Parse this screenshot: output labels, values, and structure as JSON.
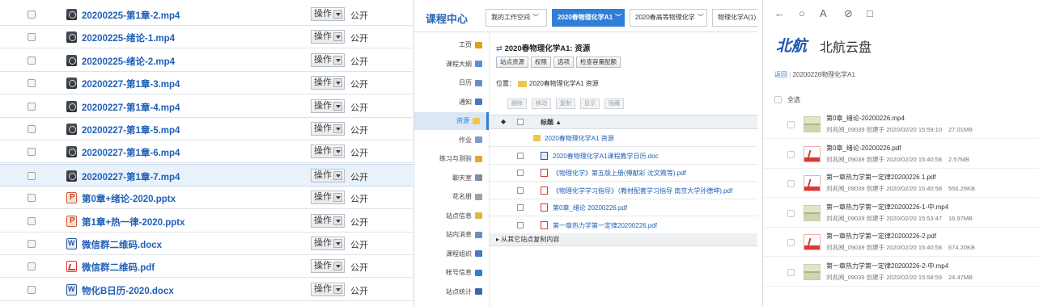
{
  "panel1": {
    "op_label": "操作",
    "public_label": "公开",
    "files": [
      {
        "name": "20200225-第1章-2.mp4",
        "type": "mp4"
      },
      {
        "name": "20200225-绪论-1.mp4",
        "type": "mp4"
      },
      {
        "name": "20200225-绪论-2.mp4",
        "type": "mp4"
      },
      {
        "name": "20200227-第1章-3.mp4",
        "type": "mp4"
      },
      {
        "name": "20200227-第1章-4.mp4",
        "type": "mp4"
      },
      {
        "name": "20200227-第1章-5.mp4",
        "type": "mp4"
      },
      {
        "name": "20200227-第1章-6.mp4",
        "type": "mp4"
      },
      {
        "name": "20200227-第1章-7.mp4",
        "type": "mp4"
      },
      {
        "name": "第0章+绪论-2020.pptx",
        "type": "ppt"
      },
      {
        "name": "第1章+热一律-2020.pptx",
        "type": "ppt"
      },
      {
        "name": "微信群二维码.docx",
        "type": "doc"
      },
      {
        "name": "微信群二维码.pdf",
        "type": "pdf"
      },
      {
        "name": "物化B日历-2020.docx",
        "type": "doc"
      }
    ],
    "selected_index": 7
  },
  "panel2": {
    "brand": "课程中心",
    "tabs": [
      {
        "label": "我的工作空间"
      },
      {
        "label": "2020春物理化学A1"
      },
      {
        "label": "2020春高等物理化学"
      },
      {
        "label": "物理化学A(1)"
      }
    ],
    "active_tab": 1,
    "nav": [
      {
        "label": "工页",
        "color": "#d9a21b"
      },
      {
        "label": "课程大纲",
        "color": "#5b8fd6"
      },
      {
        "label": "日历",
        "color": "#6a8fc2"
      },
      {
        "label": "通知",
        "color": "#4a77c0"
      },
      {
        "label": "资源",
        "color": "#f1c64c"
      },
      {
        "label": "作业",
        "color": "#7e9bc9"
      },
      {
        "label": "练习与测验",
        "color": "#e6a430"
      },
      {
        "label": "聊天室",
        "color": "#7c8fa5"
      },
      {
        "label": "花名册",
        "color": "#9aa4ae"
      },
      {
        "label": "站点信息",
        "color": "#d9b84c"
      },
      {
        "label": "站内消息",
        "color": "#6a8fc2"
      },
      {
        "label": "课程组织",
        "color": "#4a77c0"
      },
      {
        "label": "帐号信息",
        "color": "#2f7ed8"
      },
      {
        "label": "站点统计",
        "color": "#3a68b0"
      }
    ],
    "active_nav": 4,
    "title": "2020春物理化学A1: 资源",
    "subbuttons": [
      "站点资源",
      "权限",
      "选项",
      "检查容量配额"
    ],
    "location_label": "位置：",
    "location": "2020春物理化学A1 资源",
    "action_buttons": [
      "删除",
      "移动",
      "复制",
      "显示",
      "隐藏"
    ],
    "column_title": "标题 ▲",
    "items": [
      {
        "name": "2020春物理化学A1 资源",
        "type": "folder"
      },
      {
        "name": "2020春物理化学A1课程教学日历.doc",
        "type": "doc"
      },
      {
        "name": "《物理化学》第五版上册(傅献彩 沈文霞等).pdf",
        "type": "pdf"
      },
      {
        "name": "《物理化学学习指导》（教材配套学习指导 南京大学孙德坤).pdf",
        "type": "pdf"
      },
      {
        "name": "第0章_绪论 20200226.pdf",
        "type": "pdf"
      },
      {
        "name": "第一章热力学第一定律20200226.pdf",
        "type": "pdf"
      }
    ],
    "footer": "▸ 从其它站点复制内容"
  },
  "panel3": {
    "toolbar": [
      "←",
      "○",
      "A",
      "⊘",
      "□"
    ],
    "logo_text": "北航",
    "brand": "北航云盘",
    "back": "返回",
    "crumb": "20200226物理化学A1",
    "select_all": "全选",
    "files": [
      {
        "name": "第0章_绪论-20200226.mp4",
        "meta": "刘兆阅_09039 创建于 2020/02/20 15:59:10",
        "size": "27.01MB",
        "type": "video"
      },
      {
        "name": "第0章_绪论-20200226.pdf",
        "meta": "刘兆阅_09039 创建于 2020/02/20 15:40:58",
        "size": "2.57MB",
        "type": "pdf"
      },
      {
        "name": "第一章热力学第一定律20200226 1.pdf",
        "meta": "刘兆阅_09039 创建于 2020/02/20 15:40:58",
        "size": "556.29KB",
        "type": "pdf"
      },
      {
        "name": "第一章热力学第一定律20200226-1-中.mp4",
        "meta": "刘兆阅_09039 创建于 2020/02/20 15:53:47",
        "size": "16.97MB",
        "type": "video"
      },
      {
        "name": "第一章热力学第一定律20200226-2.pdf",
        "meta": "刘兆阅_09039 创建于 2020/02/20 15:40:58",
        "size": "674.20KB",
        "type": "pdf"
      },
      {
        "name": "第一章热力学第一定律20200226-2-中.mp4",
        "meta": "刘兆阅_09039 创建于 2020/02/20 15:58:59",
        "size": "24.47MB",
        "type": "video"
      }
    ]
  }
}
